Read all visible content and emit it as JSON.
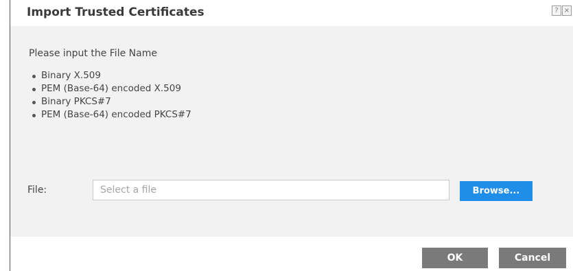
{
  "dialog": {
    "title": "Import Trusted Certificates",
    "help_icon": "question-icon",
    "help_glyph": "?",
    "close_icon": "close-icon",
    "close_glyph": "×"
  },
  "content": {
    "instruction": "Please input the File Name",
    "formats": [
      "Binary X.509",
      "PEM (Base-64) encoded X.509",
      "Binary PKCS#7",
      "PEM (Base-64) encoded PKCS#7"
    ],
    "file_label": "File:",
    "file_value": "",
    "file_placeholder": "Select a file",
    "browse_label": "Browse..."
  },
  "footer": {
    "ok_label": "OK",
    "cancel_label": "Cancel"
  },
  "colors": {
    "browse_button": "#1f8ee8",
    "footer_buttons": "#7a7a7a",
    "content_background": "#f2f2f2"
  }
}
